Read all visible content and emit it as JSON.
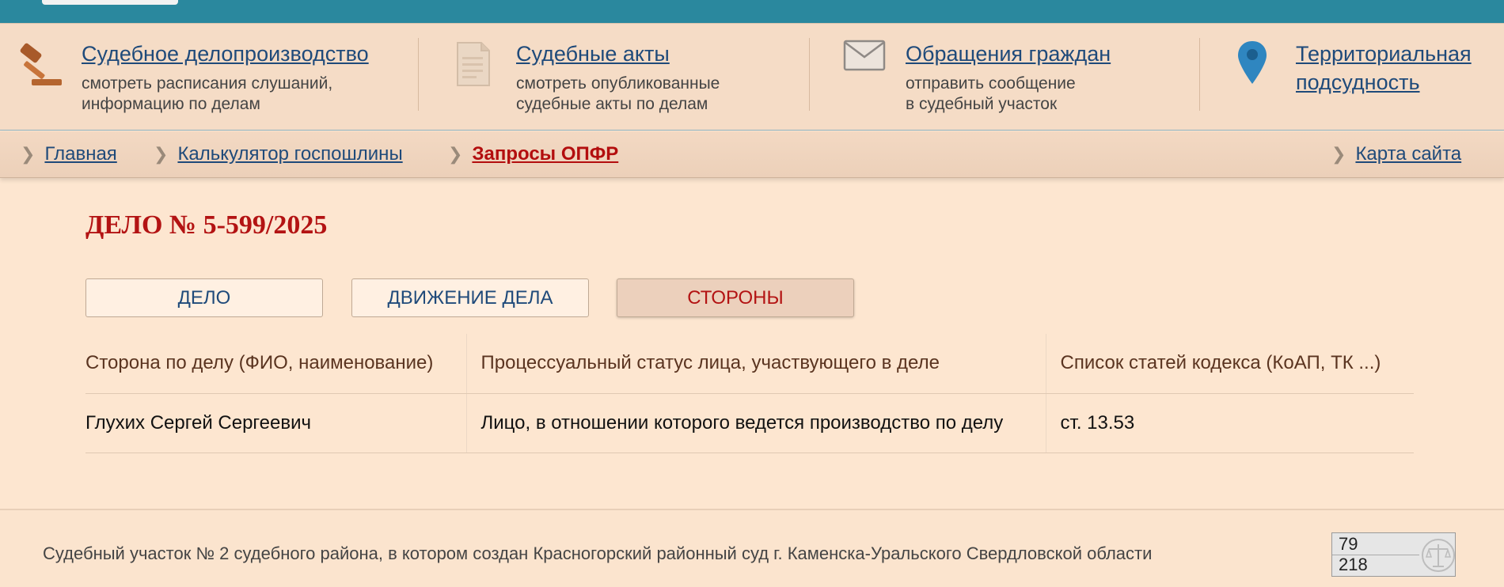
{
  "services": [
    {
      "title": "Судебное делопроизводство",
      "desc1": "смотреть расписания слушаний,",
      "desc2": "информацию по делам",
      "icon": "gavel-icon"
    },
    {
      "title": "Судебные акты",
      "desc1": "смотреть опубликованные",
      "desc2": "судебные акты по делам",
      "icon": "document-icon"
    },
    {
      "title": "Обращения граждан",
      "desc1": "отправить сообщение",
      "desc2": "в судебный участок",
      "icon": "envelope-icon"
    },
    {
      "title1": "Территориальная",
      "title2": "подсудность",
      "icon": "map-pin-icon"
    }
  ],
  "breadcrumbs": [
    {
      "label": "Главная",
      "active": false
    },
    {
      "label": "Калькулятор госпошлины",
      "active": false
    },
    {
      "label": "Запросы ОПФР",
      "active": true
    }
  ],
  "sitemap_label": "Карта сайта",
  "case_title": "ДЕЛО № 5-599/2025",
  "tabs": [
    {
      "label": "ДЕЛО",
      "active": false
    },
    {
      "label": "ДВИЖЕНИЕ ДЕЛА",
      "active": false
    },
    {
      "label": "СТОРОНЫ",
      "active": true
    }
  ],
  "table": {
    "headers": [
      "Сторона по делу (ФИО, наименование)",
      "Процессуальный статус лица, участвующего в деле",
      "Список статей кодекса (КоАП, ТК ...)"
    ],
    "rows": [
      [
        "Глухих Сергей Сергеевич",
        "Лицо, в отношении которого ведется производство по делу",
        "ст. 13.53"
      ]
    ]
  },
  "footer_text": "Судебный участок № 2 судебного района, в котором создан Красногорский районный суд г. Каменска-Уральского Свердловской области",
  "counter": {
    "today": "79",
    "total": "218",
    "icon": "scales-icon"
  },
  "colors": {
    "accent_teal": "#2a889e",
    "title_red": "#b31313",
    "link_blue": "#1f4a7a",
    "background": "#fde6d0"
  }
}
